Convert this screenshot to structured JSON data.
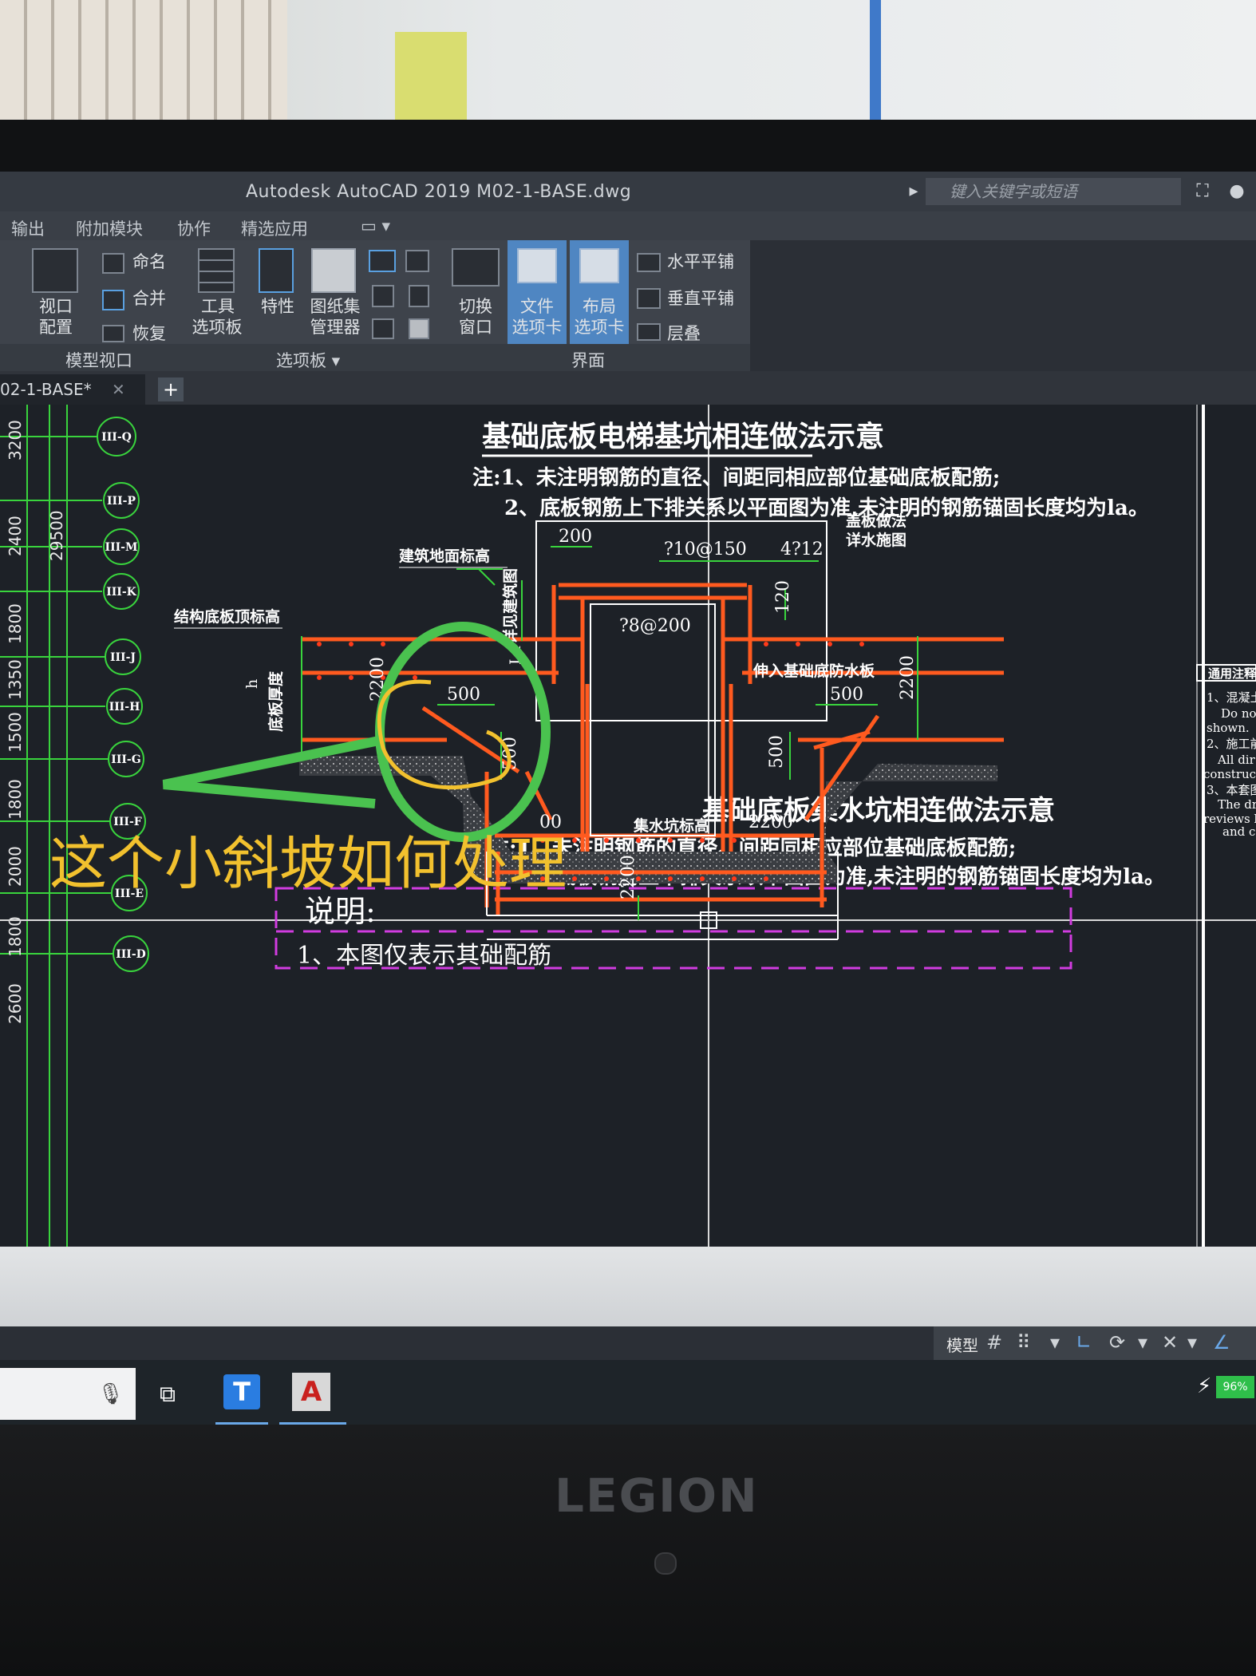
{
  "app": {
    "title": "Autodesk AutoCAD 2019    M02-1-BASE.dwg",
    "search_placeholder": "键入关键字或短语"
  },
  "menu": [
    "输出",
    "附加模块",
    "协作",
    "精选应用"
  ],
  "ribbon": {
    "viewport": {
      "label1": "视口",
      "label2": "配置",
      "rename": "命名",
      "merge": "合并",
      "restore": "恢复"
    },
    "tools": {
      "label1": "工具",
      "label2": "选项板"
    },
    "properties": "特性",
    "sheetset": {
      "label1": "图纸集",
      "label2": "管理器"
    },
    "switch": {
      "label1": "切换",
      "label2": "窗口"
    },
    "filetab": {
      "label1": "文件",
      "label2": "选项卡"
    },
    "layouttab": {
      "label1": "布局",
      "label2": "选项卡"
    },
    "tile_h": "水平平铺",
    "tile_v": "垂直平铺",
    "cascade": "层叠",
    "panels": [
      "模型视口",
      "选项板 ▾",
      "界面"
    ]
  },
  "doc_tab": "02-1-BASE*",
  "drawing": {
    "title1": "基础底板电梯基坑相连做法示意",
    "note1_1": "注:1、未注明钢筋的直径、间距同相应部位基础底板配筋;",
    "note1_2": "2、底板钢筋上下排关系以平面图为准,未注明的钢筋锚固长度均为la。",
    "title2": "基础底板集水坑相连做法示意",
    "note2_1": "注:1、未注明钢筋的直径、间距同相应部位基础底板配筋;",
    "note2_2": "2、底板钢筋上下排关系以平面图为准,未注明的钢筋锚固长度均为la。",
    "explain": "说明:",
    "explain_line": "1、本图仅表示其础配筋",
    "labels": {
      "arch_floor": "建筑地面标高",
      "struct_top": "结构底板顶标高",
      "cover_method": "盖板做法",
      "see_water": "详水施图",
      "see_arch": "详见建筑图",
      "sump": "集水坑标高",
      "into_waterproof": "伸入基础底防水板",
      "slab_thick": "底板厚度",
      "la": "La",
      "h": "h"
    },
    "dims": {
      "d200": "200",
      "rebar1": "?10@150",
      "rebar2": "4?12",
      "d120": "120",
      "rebar3": "?8@200",
      "d2200a": "2200",
      "d500a": "500",
      "d500b": "500",
      "d500c": "500",
      "d2200b": "2200",
      "d500d": "500",
      "d2200c": "2200",
      "d_00": "00",
      "d2200d": "2200"
    },
    "axes": [
      "III-Q",
      "III-P",
      "III-M",
      "III-K",
      "III-J",
      "III-H",
      "III-G",
      "III-F",
      "III-E",
      "III-D"
    ],
    "left_dims": [
      "3200",
      "2400",
      "29500",
      "1800",
      "1350",
      "1500",
      "1800",
      "2000",
      "1800",
      "2600"
    ],
    "right_panel": {
      "title": "通用注释",
      "l1": "1、混凝土",
      "l2": "Do no",
      "l3": "shown.",
      "l4": "2、施工前",
      "l5": "All dir",
      "l6": "construc",
      "l7": "3、本套图",
      "l8": "The dr",
      "l9": "reviews k",
      "l10": "and c"
    }
  },
  "annotation": "这个小斜坡如何处理",
  "status": {
    "model": "模型"
  },
  "battery": "96%",
  "brand": "LEGION"
}
